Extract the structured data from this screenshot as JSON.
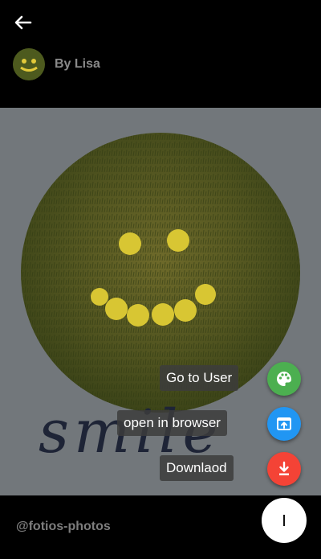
{
  "header": {
    "back_icon": "arrow-left-icon",
    "author_name": "By Lisa"
  },
  "photo": {
    "handwritten_text": "smile"
  },
  "actions": [
    {
      "label": "Go to User",
      "icon": "palette-icon",
      "color": "#4caf50"
    },
    {
      "label": "open in browser",
      "icon": "open-in-browser-icon",
      "color": "#2196f3"
    },
    {
      "label": "Downlaod",
      "icon": "download-icon",
      "color": "#f44336"
    }
  ],
  "footer": {
    "handle": "@fotios-photos",
    "menu_fab_icon": "menu-icon"
  }
}
